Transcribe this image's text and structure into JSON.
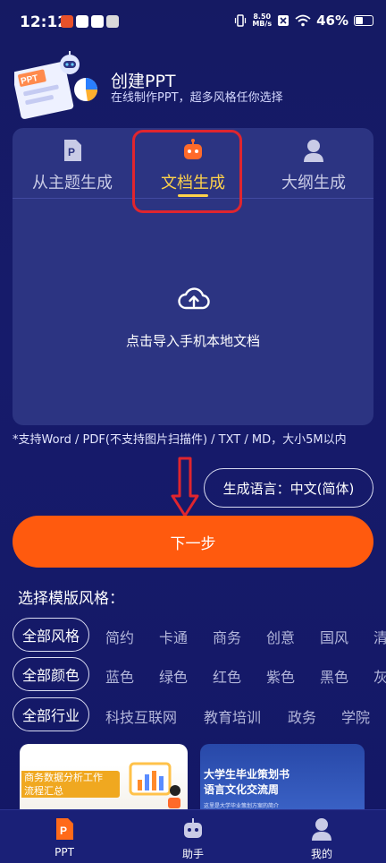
{
  "status_bar": {
    "time": "12:12",
    "net_speed": "8.50",
    "net_unit": "MB/s",
    "battery": "46%"
  },
  "header": {
    "title": "创建PPT",
    "subtitle": "在线制作PPT，超多风格任你选择"
  },
  "tabs": [
    {
      "label": "从主题生成",
      "icon": "document-p-icon"
    },
    {
      "label": "文档生成",
      "icon": "robot-icon",
      "active": true
    },
    {
      "label": "大纲生成",
      "icon": "person-icon"
    }
  ],
  "upload": {
    "label": "点击导入手机本地文档",
    "icon": "cloud-upload-icon"
  },
  "note": "*支持Word / PDF(不支持图片扫描件) / TXT / MD，大小5M以内",
  "language_button": "生成语言：中文(简体)",
  "next_button": "下一步",
  "style_section_title": "选择模版风格：",
  "filters": {
    "style": {
      "selected": "全部风格",
      "options": [
        "简约",
        "卡通",
        "商务",
        "创意",
        "国风",
        "清"
      ]
    },
    "color": {
      "selected": "全部颜色",
      "options": [
        "蓝色",
        "绿色",
        "红色",
        "紫色",
        "黑色",
        "灰"
      ]
    },
    "industry": {
      "selected": "全部行业",
      "options": [
        "科技互联网",
        "教育培训",
        "政务",
        "学院"
      ]
    }
  },
  "templates": [
    {
      "text_line1": "商务数据分析工作",
      "text_line2": "流程汇总"
    },
    {
      "text_line1": "大学生毕业策划书",
      "text_line2": "语言文化交流周",
      "small": "这里是大学毕业策划方案的简介"
    }
  ],
  "bottom_nav": [
    {
      "label": "PPT",
      "active": true
    },
    {
      "label": "助手"
    },
    {
      "label": "我的"
    }
  ],
  "colors": {
    "accent_orange": "#ff5a0e",
    "tab_active": "#ffd24a",
    "highlight_red": "#e0252e",
    "background": "#151a63"
  }
}
